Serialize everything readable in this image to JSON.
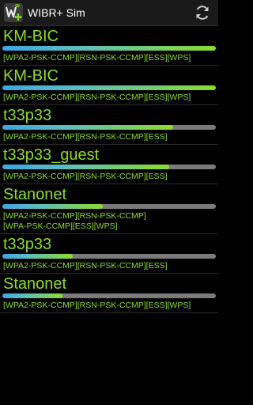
{
  "app": {
    "title": "WIBR+ Sim",
    "icon": "wibr-app-icon",
    "refresh_icon": "refresh-icon"
  },
  "colors": {
    "text_green": "#8bdc2c",
    "bar_blue": "#39a7e3",
    "bar_track": "#7a7a7a",
    "background": "#000000"
  },
  "networks": [
    {
      "ssid": "KM-BIC",
      "signal": 1.0,
      "caps": [
        "[WPA2-PSK-CCMP][RSN-PSK-CCMP][ESS][WPS]"
      ]
    },
    {
      "ssid": "KM-BIC",
      "signal": 1.0,
      "caps": [
        "[WPA2-PSK-CCMP][RSN-PSK-CCMP][ESS][WPS]"
      ]
    },
    {
      "ssid": "t33p33",
      "signal": 0.8,
      "caps": [
        "[WPA2-PSK-CCMP][RSN-PSK-CCMP][ESS]"
      ]
    },
    {
      "ssid": "t33p33_guest",
      "signal": 0.78,
      "caps": [
        "[WPA2-PSK-CCMP][RSN-PSK-CCMP][ESS]"
      ]
    },
    {
      "ssid": "Stanonet",
      "signal": 0.47,
      "caps": [
        "[WPA2-PSK-CCMP][RSN-PSK-CCMP]",
        "[WPA-PSK-CCMP][ESS][WPS]"
      ]
    },
    {
      "ssid": "t33p33",
      "signal": 0.33,
      "caps": [
        "[WPA2-PSK-CCMP][RSN-PSK-CCMP][ESS]"
      ]
    },
    {
      "ssid": "Stanonet",
      "signal": 0.28,
      "caps": [
        "[WPA2-PSK-CCMP][RSN-PSK-CCMP][ESS][WPS]"
      ]
    }
  ]
}
